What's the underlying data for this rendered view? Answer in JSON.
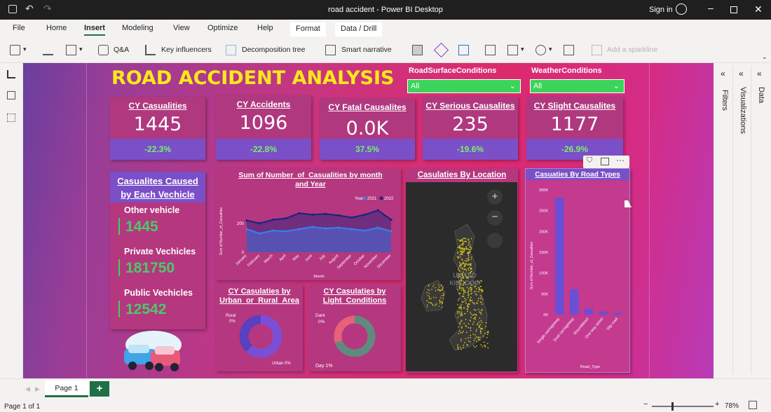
{
  "window": {
    "title": "road accident - Power BI Desktop",
    "sign_in": "Sign in"
  },
  "menu": [
    "File",
    "Home",
    "Insert",
    "Modeling",
    "View",
    "Optimize",
    "Help",
    "Format",
    "Data / Drill"
  ],
  "ribbon": {
    "qa": "Q&A",
    "key_influencers": "Key influencers",
    "decomposition_tree": "Decomposition tree",
    "smart_narrative": "Smart narrative",
    "add_sparkline": "Add a sparkline"
  },
  "dashboard": {
    "title": "ROAD ACCIDENT  ANALYSIS",
    "slicers": [
      {
        "label": "RoadSurfaceConditions",
        "value": "All"
      },
      {
        "label": "WeatherConditions",
        "value": "All"
      }
    ],
    "kpis": [
      {
        "title": "CY Casualities",
        "value": "1445",
        "change": "-22.3%"
      },
      {
        "title": "CY Accidents",
        "value": "1096",
        "change": "-22.8%"
      },
      {
        "title": "CY Fatal Causalites",
        "value": "0.0K",
        "change": "37.5%"
      },
      {
        "title": "CY Serious Causalites",
        "value": "235",
        "change": "-19.6%"
      },
      {
        "title": "CY Slight Causalites",
        "value": "1177",
        "change": "-26.9%"
      }
    ],
    "vehicles": {
      "title": "Casualites Caused by Each Vechicle",
      "items": [
        {
          "label": "Other vehicle",
          "value": "1445"
        },
        {
          "label": "Private Vechicles",
          "value": "181750"
        },
        {
          "label": "Public Vechicles",
          "value": "12542"
        }
      ]
    },
    "line_title": "Sum of Number_of_Casualities by month and Year",
    "location_title": "Casulaties By Location",
    "map_label": "UNITED KINGDOM",
    "urban_title": "CY Casulaties by Urban_or_Rural_Area",
    "urban_labels": {
      "rural": "Rural",
      "rural_pct": "0%",
      "urban": "Urban 0%"
    },
    "light_title": "CY Casulaties by Light_Conditions",
    "light_labels": {
      "dark": "Dark",
      "dark_pct": "0%",
      "day": "Day 1%"
    },
    "road_title": "Casuaties By Road Types"
  },
  "chart_data": [
    {
      "type": "line",
      "title": "Sum of Number_of_Casualities by month and Year",
      "xlabel": "Month",
      "ylabel": "Sum of Number_of_Casualties",
      "legend_title": "Year",
      "legend_position": "top-right",
      "categories": [
        "January",
        "February",
        "March",
        "April",
        "May",
        "June",
        "July",
        "August",
        "September",
        "October",
        "November",
        "December"
      ],
      "series": [
        {
          "name": "2021",
          "color": "#3a7ff0",
          "values": [
            160,
            130,
            150,
            145,
            160,
            175,
            165,
            170,
            160,
            150,
            170,
            145
          ]
        },
        {
          "name": "2022",
          "color": "#1a237e",
          "values": [
            220,
            200,
            225,
            235,
            270,
            260,
            265,
            255,
            240,
            260,
            290,
            225
          ]
        }
      ],
      "yticks": [
        0,
        200
      ],
      "ylim": [
        0,
        320
      ]
    },
    {
      "type": "bar",
      "title": "Casuaties By Road Types",
      "xlabel": "Road_Type",
      "ylabel": "Sum of Number_of_Casualties",
      "categories": [
        "Single carriageway",
        "Dual carriageway",
        "Roundabout",
        "One way street",
        "Slip road"
      ],
      "values": [
        3000,
        650,
        150,
        80,
        50
      ],
      "yticks": [
        "300K",
        "250K",
        "200K",
        "150K",
        "100K",
        "50K",
        "0K"
      ],
      "ylim": [
        0,
        3200
      ],
      "color": "#6a4fd6"
    },
    {
      "type": "pie",
      "title": "CY Casulaties by Urban_or_Rural_Area",
      "categories": [
        "Urban",
        "Rural"
      ],
      "values": [
        62,
        38
      ],
      "colors": [
        "#7a4fd6",
        "#5a3fc0"
      ]
    },
    {
      "type": "pie",
      "title": "CY Casulaties by Light_Conditions",
      "categories": [
        "Day",
        "Dark"
      ],
      "values": [
        70,
        30
      ],
      "colors": [
        "#5f8b7e",
        "#e8607a"
      ]
    }
  ],
  "panes": {
    "filters": "Filters",
    "visualizations": "Visualizations",
    "data": "Data"
  },
  "status": {
    "page_tab": "Page 1",
    "page_count": "Page 1 of 1",
    "zoom": "78%"
  }
}
